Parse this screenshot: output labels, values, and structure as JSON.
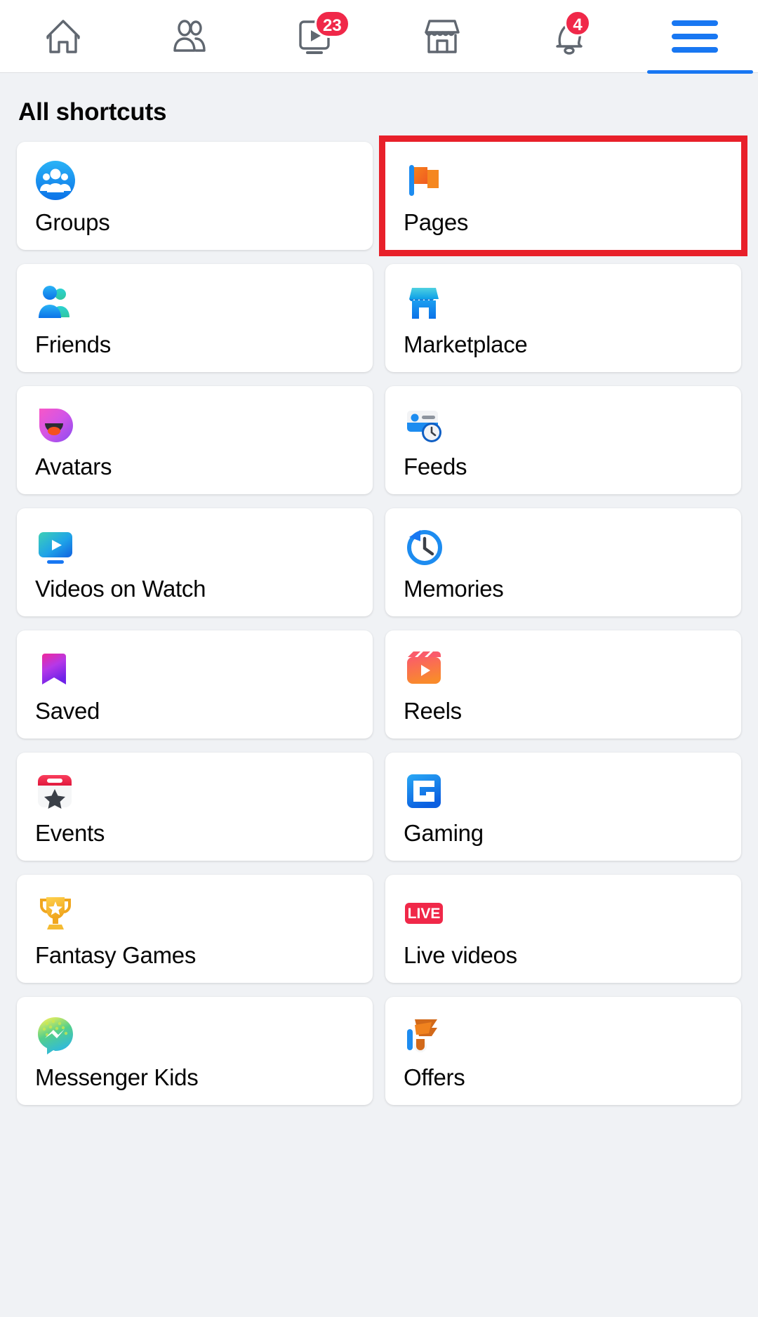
{
  "top_nav": {
    "tabs": [
      {
        "name": "home",
        "icon": "home-icon",
        "badge": null,
        "active": false
      },
      {
        "name": "friends",
        "icon": "friends-icon",
        "badge": null,
        "active": false
      },
      {
        "name": "watch",
        "icon": "watch-video-icon",
        "badge": "23",
        "active": false
      },
      {
        "name": "marketplace",
        "icon": "marketplace-icon",
        "badge": null,
        "active": false
      },
      {
        "name": "notifications",
        "icon": "notifications-bell-icon",
        "badge": "4",
        "active": false
      },
      {
        "name": "menu",
        "icon": "hamburger-menu-icon",
        "badge": null,
        "active": true
      }
    ],
    "badge_color": "#f02849",
    "accent_color": "#1877f2"
  },
  "page": {
    "title": "All shortcuts"
  },
  "shortcuts": [
    {
      "label": "Groups",
      "icon": "groups-icon",
      "highlighted": false
    },
    {
      "label": "Pages",
      "icon": "pages-flag-icon",
      "highlighted": true
    },
    {
      "label": "Friends",
      "icon": "friends-people-icon",
      "highlighted": false
    },
    {
      "label": "Marketplace",
      "icon": "marketplace-shop-icon",
      "highlighted": false
    },
    {
      "label": "Avatars",
      "icon": "avatars-face-icon",
      "highlighted": false
    },
    {
      "label": "Feeds",
      "icon": "feeds-clock-card-icon",
      "highlighted": false
    },
    {
      "label": "Videos on Watch",
      "icon": "video-monitor-icon",
      "highlighted": false
    },
    {
      "label": "Memories",
      "icon": "memories-clock-icon",
      "highlighted": false
    },
    {
      "label": "Saved",
      "icon": "saved-bookmark-icon",
      "highlighted": false
    },
    {
      "label": "Reels",
      "icon": "reels-clapper-icon",
      "highlighted": false
    },
    {
      "label": "Events",
      "icon": "events-calendar-icon",
      "highlighted": false
    },
    {
      "label": "Gaming",
      "icon": "gaming-controller-icon",
      "highlighted": false
    },
    {
      "label": "Fantasy Games",
      "icon": "trophy-icon",
      "highlighted": false
    },
    {
      "label": "Live videos",
      "icon": "live-badge-icon",
      "highlighted": false
    },
    {
      "label": "Messenger Kids",
      "icon": "messenger-kids-icon",
      "highlighted": false
    },
    {
      "label": "Offers",
      "icon": "offers-megaphone-icon",
      "highlighted": false
    }
  ],
  "highlight": {
    "color": "#e8202a",
    "target_label": "Pages"
  },
  "live_badge_text": "LIVE"
}
